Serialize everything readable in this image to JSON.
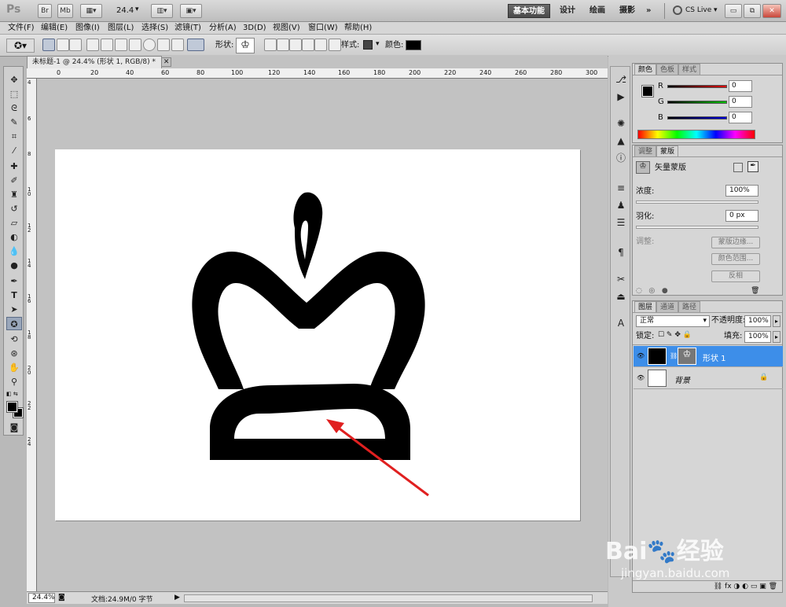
{
  "appbar": {
    "logo": "Ps",
    "bridge": "Br",
    "mini": "Mb",
    "zoom": "24.4",
    "workspaces": [
      "基本功能",
      "设计",
      "绘画",
      "摄影"
    ],
    "more": "»",
    "cslive": "CS Live"
  },
  "menu": [
    "文件(F)",
    "编辑(E)",
    "图像(I)",
    "图层(L)",
    "选择(S)",
    "滤镜(T)",
    "分析(A)",
    "3D(D)",
    "视图(V)",
    "窗口(W)",
    "帮助(H)"
  ],
  "options": {
    "shape_label": "形状:",
    "style_label": "样式:",
    "color_label": "颜色:",
    "color": "#000000"
  },
  "document": {
    "tab": "未标题-1 @ 24.4% (形状 1, RGB/8) *",
    "ruler_top": [
      "0",
      "20",
      "40",
      "60",
      "80",
      "100",
      "120",
      "140",
      "160",
      "180",
      "200",
      "220",
      "240",
      "260",
      "280",
      "300"
    ],
    "ruler_left": [
      "4",
      "6",
      "8",
      "10",
      "12",
      "14",
      "16",
      "18",
      "20",
      "22",
      "24"
    ],
    "zoom": "24.4%",
    "doc_info": "文档:24.9M/0 字节"
  },
  "color_panel": {
    "tabs": [
      "颜色",
      "色板",
      "样式"
    ],
    "r_label": "R",
    "g_label": "G",
    "b_label": "B",
    "r": "0",
    "g": "0",
    "b": "0"
  },
  "mask_panel": {
    "tabs": [
      "调整",
      "蒙版"
    ],
    "title": "矢量蒙版",
    "density_label": "浓度:",
    "density": "100%",
    "feather_label": "羽化:",
    "feather": "0 px",
    "refine_label": "调整:",
    "btn_edge": "蒙版边缘...",
    "btn_range": "颜色范围...",
    "btn_invert": "反相"
  },
  "layers_panel": {
    "tabs": [
      "图层",
      "通道",
      "路径"
    ],
    "blend_mode": "正常",
    "opacity_label": "不透明度:",
    "opacity": "100%",
    "lock_label": "锁定:",
    "fill_label": "填充:",
    "fill": "100%",
    "layers": [
      {
        "name": "形状 1",
        "selected": true
      },
      {
        "name": "背景",
        "selected": false
      }
    ]
  },
  "watermark": {
    "brand": "Bai",
    "brand2": "经验",
    "url": "jingyan.baidu.com"
  }
}
